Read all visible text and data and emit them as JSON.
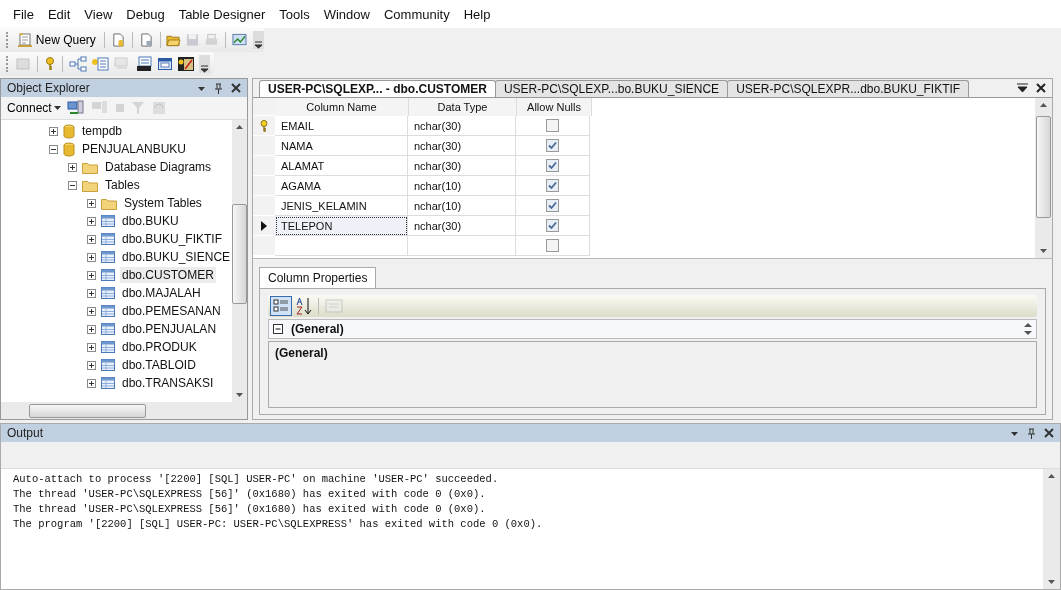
{
  "menu": [
    "File",
    "Edit",
    "View",
    "Debug",
    "Table Designer",
    "Tools",
    "Window",
    "Community",
    "Help"
  ],
  "toolbar": {
    "new_query": "New Query"
  },
  "object_explorer": {
    "title": "Object Explorer",
    "connect": "Connect",
    "tree": [
      {
        "label": "tempdb",
        "kind": "database",
        "expanded": false,
        "selected": false
      },
      {
        "label": "PENJUALANBUKU",
        "kind": "database",
        "expanded": true,
        "selected": false,
        "children": [
          {
            "label": "Database Diagrams",
            "kind": "folder",
            "expanded": false,
            "selected": false
          },
          {
            "label": "Tables",
            "kind": "folder",
            "expanded": true,
            "selected": false,
            "children": [
              {
                "label": "System Tables",
                "kind": "folder",
                "expanded": false,
                "selected": false
              },
              {
                "label": "dbo.BUKU",
                "kind": "table",
                "expanded": false,
                "selected": false
              },
              {
                "label": "dbo.BUKU_FIKTIF",
                "kind": "table",
                "expanded": false,
                "selected": false
              },
              {
                "label": "dbo.BUKU_SIENCE",
                "kind": "table",
                "expanded": false,
                "selected": false
              },
              {
                "label": "dbo.CUSTOMER",
                "kind": "table",
                "expanded": false,
                "selected": true
              },
              {
                "label": "dbo.MAJALAH",
                "kind": "table",
                "expanded": false,
                "selected": false
              },
              {
                "label": "dbo.PEMESANAN",
                "kind": "table",
                "expanded": false,
                "selected": false
              },
              {
                "label": "dbo.PENJUALAN",
                "kind": "table",
                "expanded": false,
                "selected": false
              },
              {
                "label": "dbo.PRODUK",
                "kind": "table",
                "expanded": false,
                "selected": false
              },
              {
                "label": "dbo.TABLOID",
                "kind": "table",
                "expanded": false,
                "selected": false
              },
              {
                "label": "dbo.TRANSAKSI",
                "kind": "table",
                "expanded": false,
                "selected": false
              }
            ]
          }
        ]
      }
    ]
  },
  "document_tabs": [
    {
      "label": "USER-PC\\SQLEXP... - dbo.CUSTOMER",
      "selected": true
    },
    {
      "label": "USER-PC\\SQLEXP...bo.BUKU_SIENCE",
      "selected": false
    },
    {
      "label": "USER-PC\\SQLEXPR...dbo.BUKU_FIKTIF",
      "selected": false
    }
  ],
  "table_designer": {
    "columns": [
      "Column Name",
      "Data Type",
      "Allow Nulls"
    ],
    "rows": [
      {
        "name": "EMAIL",
        "type": "nchar(30)",
        "allow_nulls": false,
        "primary_key": true,
        "current": false
      },
      {
        "name": "NAMA",
        "type": "nchar(30)",
        "allow_nulls": true,
        "primary_key": false,
        "current": false
      },
      {
        "name": "ALAMAT",
        "type": "nchar(30)",
        "allow_nulls": true,
        "primary_key": false,
        "current": false
      },
      {
        "name": "AGAMA",
        "type": "nchar(10)",
        "allow_nulls": true,
        "primary_key": false,
        "current": false
      },
      {
        "name": "JENIS_KELAMIN",
        "type": "nchar(10)",
        "allow_nulls": true,
        "primary_key": false,
        "current": false
      },
      {
        "name": "TELEPON",
        "type": "nchar(30)",
        "allow_nulls": true,
        "primary_key": false,
        "current": true
      }
    ],
    "new_row": {
      "allow_nulls": false
    }
  },
  "column_properties": {
    "tabs": [
      {
        "label": "Column Properties",
        "selected": true
      }
    ],
    "category": {
      "label": "(General)",
      "expanded": true
    },
    "description": "(General)"
  },
  "output": {
    "title": "Output",
    "lines": [
      "Auto-attach to process '[2200] [SQL] USER-PC' on machine 'USER-PC' succeeded.",
      "The thread 'USER-PC\\SQLEXPRESS [56]' (0x1680) has exited with code 0 (0x0).",
      "The thread 'USER-PC\\SQLEXPRESS [56]' (0x1680) has exited with code 0 (0x0).",
      "The program '[2200] [SQL] USER-PC: USER-PC\\SQLEXPRESS' has exited with code 0 (0x0)."
    ]
  }
}
